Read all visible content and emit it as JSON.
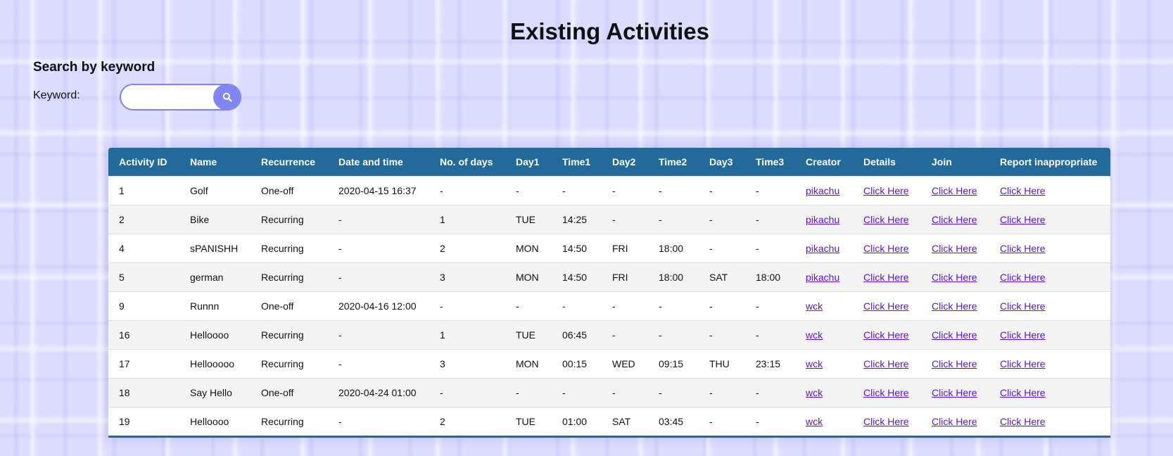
{
  "page": {
    "title": "Existing Activities"
  },
  "search": {
    "heading": "Search by keyword",
    "keyword_label": "Keyword:",
    "value": "",
    "placeholder": ""
  },
  "table": {
    "headers": [
      "Activity ID",
      "Name",
      "Recurrence",
      "Date and time",
      "No. of days",
      "Day1",
      "Time1",
      "Day2",
      "Time2",
      "Day3",
      "Time3",
      "Creator",
      "Details",
      "Join",
      "Report inappropriate"
    ],
    "rows": [
      {
        "id": "1",
        "name": "Golf",
        "recurrence": "One-off",
        "datetime": "2020-04-15 16:37",
        "days": "-",
        "day1": "-",
        "time1": "-",
        "day2": "-",
        "time2": "-",
        "day3": "-",
        "time3": "-",
        "creator": "pikachu",
        "details": "Click Here",
        "join": "Click Here",
        "report": "Click Here"
      },
      {
        "id": "2",
        "name": "Bike",
        "recurrence": "Recurring",
        "datetime": "-",
        "days": "1",
        "day1": "TUE",
        "time1": "14:25",
        "day2": "-",
        "time2": "-",
        "day3": "-",
        "time3": "-",
        "creator": "pikachu",
        "details": "Click Here",
        "join": "Click Here",
        "report": "Click Here"
      },
      {
        "id": "4",
        "name": "sPANISHH",
        "recurrence": "Recurring",
        "datetime": "-",
        "days": "2",
        "day1": "MON",
        "time1": "14:50",
        "day2": "FRI",
        "time2": "18:00",
        "day3": "-",
        "time3": "-",
        "creator": "pikachu",
        "details": "Click Here",
        "join": "Click Here",
        "report": "Click Here"
      },
      {
        "id": "5",
        "name": "german",
        "recurrence": "Recurring",
        "datetime": "-",
        "days": "3",
        "day1": "MON",
        "time1": "14:50",
        "day2": "FRI",
        "time2": "18:00",
        "day3": "SAT",
        "time3": "18:00",
        "creator": "pikachu",
        "details": "Click Here",
        "join": "Click Here",
        "report": "Click Here"
      },
      {
        "id": "9",
        "name": "Runnn",
        "recurrence": "One-off",
        "datetime": "2020-04-16 12:00",
        "days": "-",
        "day1": "-",
        "time1": "-",
        "day2": "-",
        "time2": "-",
        "day3": "-",
        "time3": "-",
        "creator": "wck",
        "details": "Click Here",
        "join": "Click Here",
        "report": "Click Here"
      },
      {
        "id": "16",
        "name": "Helloooo",
        "recurrence": "Recurring",
        "datetime": "-",
        "days": "1",
        "day1": "TUE",
        "time1": "06:45",
        "day2": "-",
        "time2": "-",
        "day3": "-",
        "time3": "-",
        "creator": "wck",
        "details": "Click Here",
        "join": "Click Here",
        "report": "Click Here"
      },
      {
        "id": "17",
        "name": "Hellooooo",
        "recurrence": "Recurring",
        "datetime": "-",
        "days": "3",
        "day1": "MON",
        "time1": "00:15",
        "day2": "WED",
        "time2": "09:15",
        "day3": "THU",
        "time3": "23:15",
        "creator": "wck",
        "details": "Click Here",
        "join": "Click Here",
        "report": "Click Here"
      },
      {
        "id": "18",
        "name": "Say Hello",
        "recurrence": "One-off",
        "datetime": "2020-04-24 01:00",
        "days": "-",
        "day1": "-",
        "time1": "-",
        "day2": "-",
        "time2": "-",
        "day3": "-",
        "time3": "-",
        "creator": "wck",
        "details": "Click Here",
        "join": "Click Here",
        "report": "Click Here"
      },
      {
        "id": "19",
        "name": "Helloooo",
        "recurrence": "Recurring",
        "datetime": "-",
        "days": "2",
        "day1": "TUE",
        "time1": "01:00",
        "day2": "SAT",
        "time2": "03:45",
        "day3": "-",
        "time3": "-",
        "creator": "wck",
        "details": "Click Here",
        "join": "Click Here",
        "report": "Click Here"
      }
    ]
  },
  "icons": {
    "search": "search-icon"
  },
  "colors": {
    "header_bg": "#216a9a",
    "accent": "#7f86f2",
    "link": "#5a14c8"
  }
}
